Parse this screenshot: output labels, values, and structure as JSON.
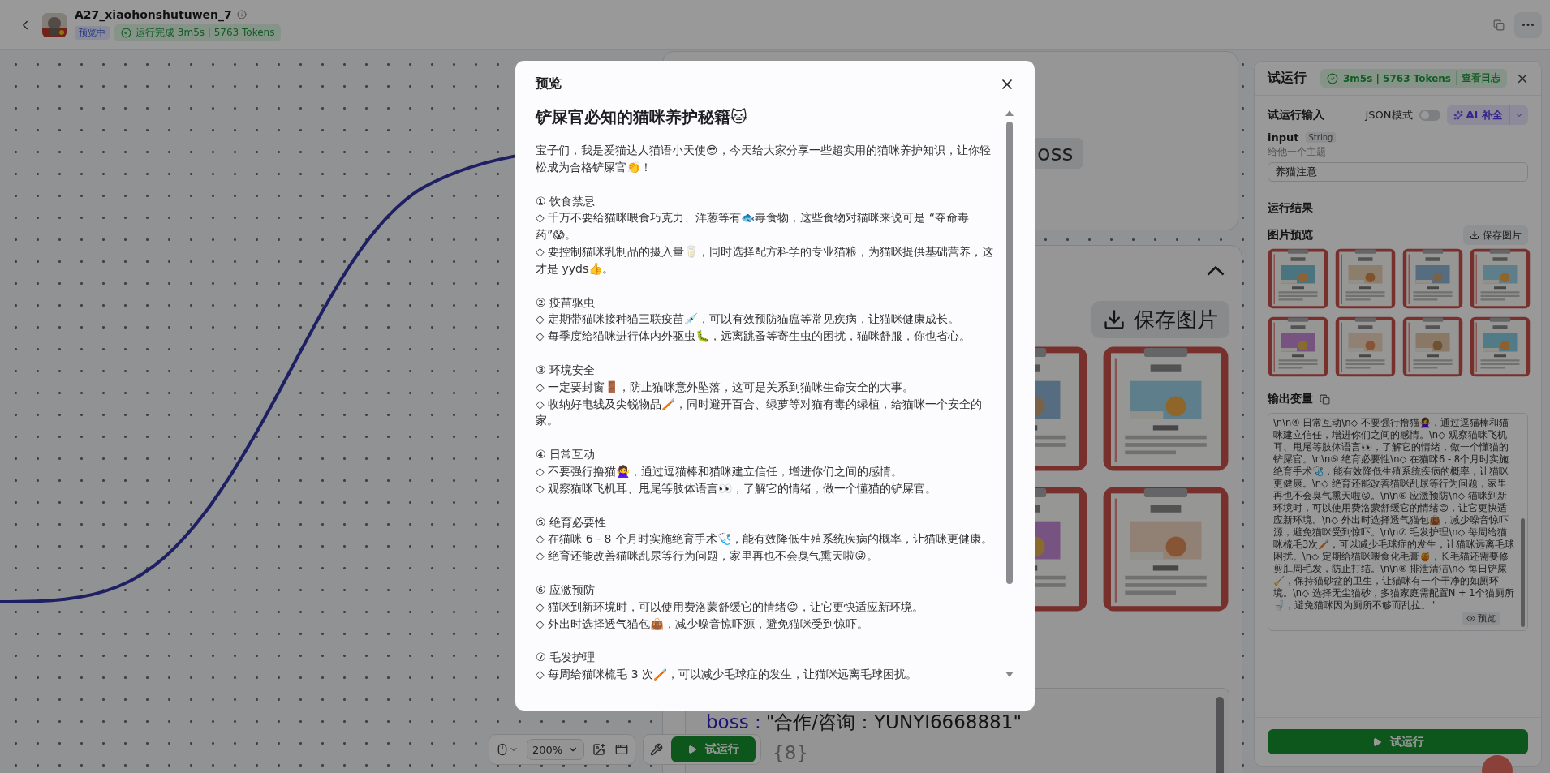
{
  "header": {
    "title": "A27_xiaohonshutuwen_7",
    "status_tag": "预览中",
    "run_status": "运行完成 3m5s | 5763 Tokens"
  },
  "canvas": {
    "top_node": {
      "tag": "oss"
    },
    "image_node": {
      "expanded": true,
      "save_button": "保存图片"
    },
    "code_lines": [
      {
        "kind": "pair",
        "key": "boss :",
        "value": "\"合作/咨询：YUNYI6668881\""
      },
      {
        "kind": "count",
        "value": "{8}"
      }
    ],
    "toolbar": {
      "zoom": "200%",
      "run_button": "试运行"
    }
  },
  "right_panel": {
    "title": "试运行",
    "run_stats": "3m5s | 5763 Tokens",
    "log_link": "查看日志",
    "input_section": "试运行输入",
    "json_mode": {
      "label": "JSON模式",
      "on": false
    },
    "ai_button": "AI 补全",
    "input": {
      "name": "input",
      "type": "String",
      "hint": "给他一个主题",
      "value": "养猫注意"
    },
    "result_section": "运行结果",
    "image_preview": {
      "label": "图片预览",
      "save_button": "保存图片"
    },
    "output": {
      "label": "输出变量",
      "text": "\\n\\n④ 日常互动\\n◇ 不要强行撸猫🙅‍♀️，通过逗猫棒和猫咪建立信任，增进你们之间的感情。\\n◇ 观察猫咪飞机耳、甩尾等肢体语言👀，了解它的情绪，做一个懂猫的铲屎官。\\n\\n⑤ 绝育必要性\\n◇ 在猫咪6 - 8个月时实施绝育手术🩺，能有效降低生殖系统疾病的概率，让猫咪更健康。\\n◇ 绝育还能改善猫咪乱尿等行为问题，家里再也不会臭气熏天啦😜。\\n\\n⑥ 应激预防\\n◇ 猫咪到新环境时，可以使用费洛蒙舒缓它的情绪😌，让它更快适应新环境。\\n◇ 外出时选择透气猫包👜，减少噪音惊吓源，避免猫咪受到惊吓。\\n\\n⑦ 毛发护理\\n◇ 每周给猫咪梳毛3次🪥，可以减少毛球症的发生，让猫咪远离毛球困扰。\\n◇ 定期给猫咪喂食化毛膏🍯，长毛猫还需要修剪肛周毛发，防止打结。\\n\\n⑧ 排泄清洁\\n◇ 每日铲屎🧹，保持猫砂盆的卫生，让猫咪有一个干净的如厕环境。\\n◇ 选择无尘猫砂，多猫家庭需配置N + 1个猫厕所🚽，避免猫咪因为厕所不够而乱拉。\"",
      "preview_label": "预览"
    },
    "run_button": "试运行"
  },
  "modal": {
    "title": "预览",
    "heading": "铲屎官必知的猫咪养护秘籍🐱",
    "intro": "宝子们，我是爱猫达人猫语小天使😎，今天给大家分享一些超实用的猫咪养护知识，让你轻松成为合格铲屎官👏！",
    "sections": [
      {
        "title": "① 饮食禁忌",
        "items": [
          "◇ 千万不要给猫咪喂食巧克力、洋葱等有🐟毒食物，这些食物对猫咪来说可是 “夺命毒药”😱。",
          "◇ 要控制猫咪乳制品的摄入量🥛，同时选择配方科学的专业猫粮，为猫咪提供基础营养，这才是 yyds👍。"
        ]
      },
      {
        "title": "② 疫苗驱虫",
        "items": [
          "◇ 定期带猫咪接种猫三联疫苗💉，可以有效预防猫瘟等常见疾病，让猫咪健康成长。",
          "◇ 每季度给猫咪进行体内外驱虫🐛，远离跳蚤等寄生虫的困扰，猫咪舒服，你也省心。"
        ]
      },
      {
        "title": "③ 环境安全",
        "items": [
          "◇ 一定要封窗🚪，防止猫咪意外坠落，这可是关系到猫咪生命安全的大事。",
          "◇ 收纳好电线及尖锐物品🪥，同时避开百合、绿萝等对猫有毒的绿植，给猫咪一个安全的家。"
        ]
      },
      {
        "title": "④ 日常互动",
        "items": [
          "◇ 不要强行撸猫🙅‍♀️，通过逗猫棒和猫咪建立信任，增进你们之间的感情。",
          "◇ 观察猫咪飞机耳、甩尾等肢体语言👀，了解它的情绪，做一个懂猫的铲屎官。"
        ]
      },
      {
        "title": "⑤ 绝育必要性",
        "items": [
          "◇ 在猫咪 6 - 8 个月时实施绝育手术🩺，能有效降低生殖系统疾病的概率，让猫咪更健康。",
          "◇ 绝育还能改善猫咪乱尿等行为问题，家里再也不会臭气熏天啦😜。"
        ]
      },
      {
        "title": "⑥ 应激预防",
        "items": [
          "◇ 猫咪到新环境时，可以使用费洛蒙舒缓它的情绪😌，让它更快适应新环境。",
          "◇ 外出时选择透气猫包👜，减少噪音惊吓源，避免猫咪受到惊吓。"
        ]
      },
      {
        "title": "⑦ 毛发护理",
        "items": [
          "◇ 每周给猫咪梳毛 3 次🪥，可以减少毛球症的发生，让猫咪远离毛球困扰。"
        ]
      }
    ]
  }
}
